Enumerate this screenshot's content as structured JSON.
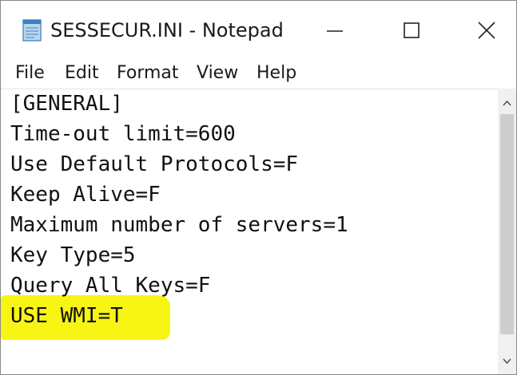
{
  "window": {
    "title": "SESSECUR.INI - Notepad",
    "app_icon": "notepad-icon",
    "controls": {
      "minimize_icon": "minimize-icon",
      "maximize_icon": "maximize-icon",
      "close_icon": "close-icon"
    }
  },
  "menu": {
    "items": [
      {
        "label": "File"
      },
      {
        "label": "Edit"
      },
      {
        "label": "Format"
      },
      {
        "label": "View"
      },
      {
        "label": "Help"
      }
    ]
  },
  "editor": {
    "lines": [
      "[GENERAL]",
      "Time-out limit=600",
      "Use Default Protocols=F",
      "Keep Alive=F",
      "Maximum number of servers=1",
      "Key Type=5",
      "Query All Keys=F",
      "USE WMI=T"
    ],
    "highlighted_line_index": 7,
    "highlight_color": "#f7f300"
  },
  "scrollbar": {
    "up_icon": "scroll-up-arrow-icon",
    "down_icon": "scroll-down-arrow-icon"
  }
}
